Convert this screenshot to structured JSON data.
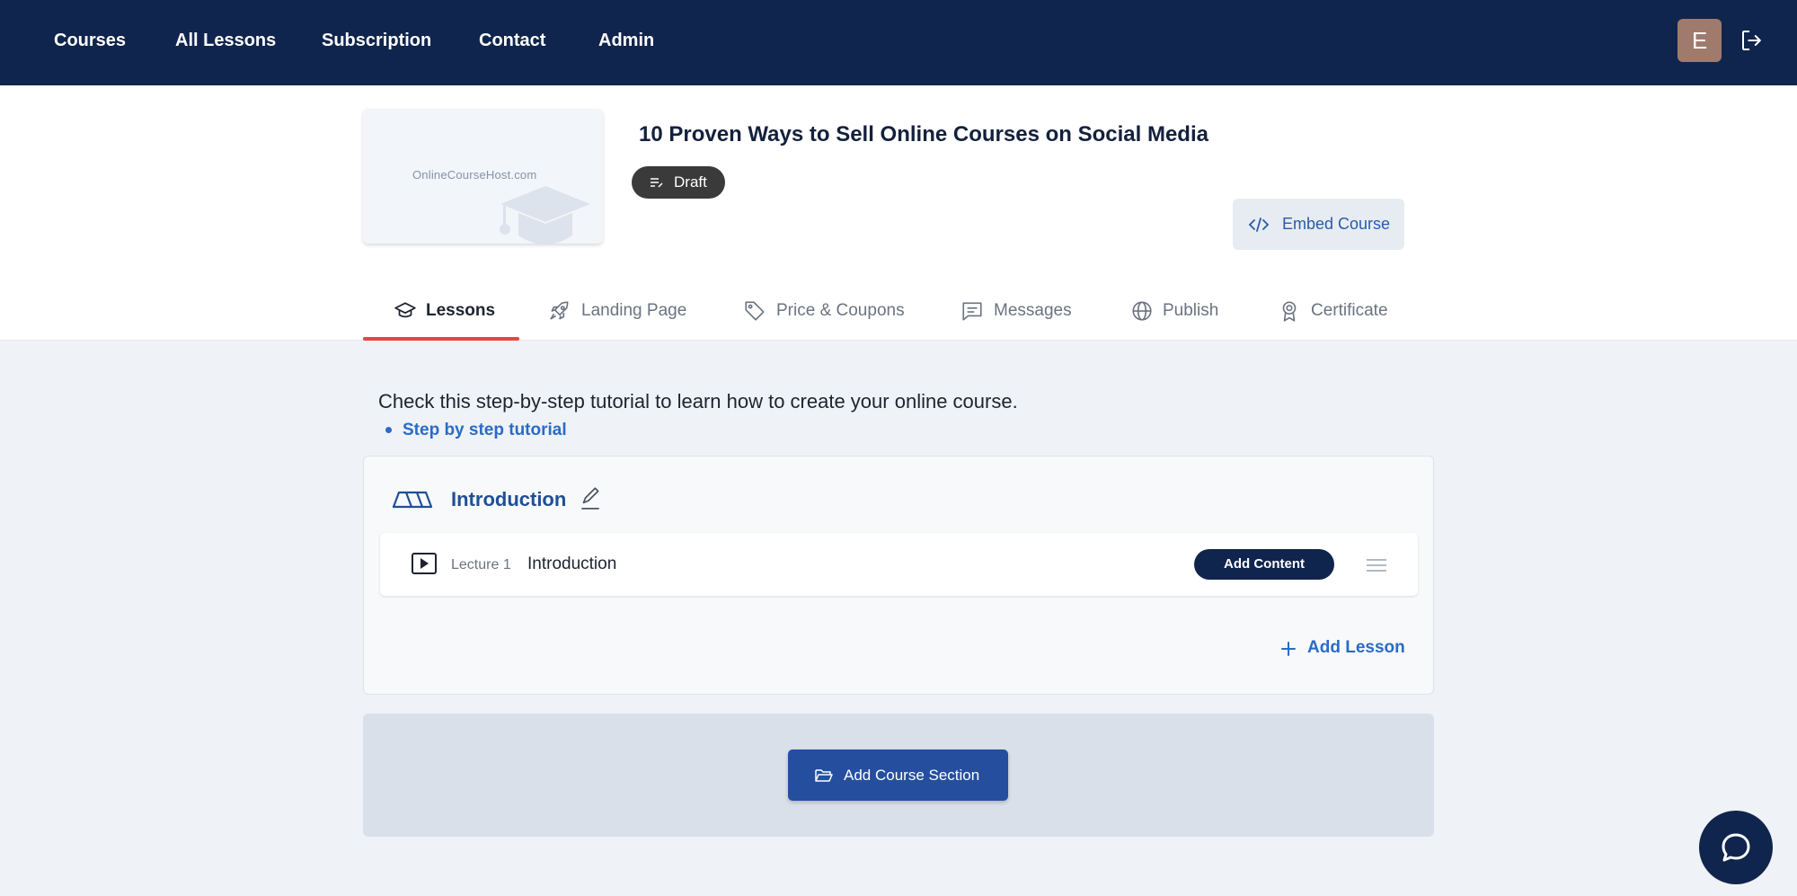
{
  "nav": {
    "items": [
      {
        "label": "Courses"
      },
      {
        "label": "All Lessons"
      },
      {
        "label": "Subscription"
      },
      {
        "label": "Contact"
      },
      {
        "label": "Admin"
      }
    ],
    "avatar_initial": "E"
  },
  "course": {
    "title": "10 Proven Ways to Sell Online Courses on Social Media",
    "status": "Draft",
    "thumbnail_text": "OnlineCourseHost.com",
    "embed_label": "Embed Course"
  },
  "tabs": [
    {
      "label": "Lessons",
      "icon": "graduation-cap-icon",
      "active": true
    },
    {
      "label": "Landing Page",
      "icon": "rocket-icon",
      "active": false
    },
    {
      "label": "Price & Coupons",
      "icon": "tag-icon",
      "active": false
    },
    {
      "label": "Messages",
      "icon": "message-icon",
      "active": false
    },
    {
      "label": "Publish",
      "icon": "globe-icon",
      "active": false
    },
    {
      "label": "Certificate",
      "icon": "award-icon",
      "active": false
    }
  ],
  "tutorial": {
    "text": "Check this step-by-step tutorial to learn how to create your online course.",
    "link_label": "Step by step tutorial"
  },
  "section": {
    "title": "Introduction",
    "lectures": [
      {
        "number": "Lecture 1",
        "title": "Introduction",
        "action": "Add Content"
      }
    ],
    "add_lesson_label": "Add Lesson"
  },
  "add_section_label": "Add Course Section",
  "colors": {
    "nav_bg": "#10254d",
    "accent_blue": "#2a6bc6",
    "tab_underline": "#e74343",
    "primary_button": "#254f9e"
  }
}
